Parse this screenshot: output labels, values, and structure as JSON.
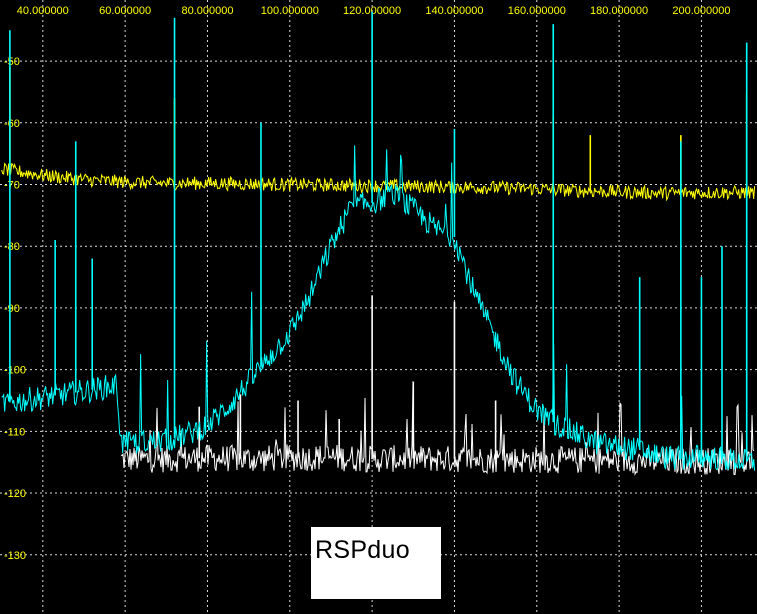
{
  "chart_data": {
    "type": "line",
    "title": "",
    "xlabel": "",
    "ylabel": "",
    "x_tick_labels": [
      "40.000000",
      "60.000000",
      "80.000000",
      "100.000000",
      "120.000000",
      "140.000000",
      "160.000000",
      "180.000000",
      "200.000000"
    ],
    "x_ticks": [
      40,
      60,
      80,
      100,
      120,
      140,
      160,
      180,
      200
    ],
    "y_tick_labels": [
      "-50",
      "-60",
      "-70",
      "-80",
      "-90",
      "-100",
      "-110",
      "-120",
      "-130"
    ],
    "y_ticks": [
      -50,
      -60,
      -70,
      -80,
      -90,
      -100,
      -110,
      -120,
      -130
    ],
    "xlim": [
      29.6,
      213.5
    ],
    "ylim": [
      -139.6,
      -40.1
    ],
    "grid": true,
    "colors": {
      "background": "#000000",
      "grid": "#ffffff",
      "tick_labels": "#ffff00",
      "series_yellow": "#ffff00",
      "series_cyan": "#00ffff",
      "series_white": "#ffffff"
    },
    "series": [
      {
        "color": "#ffff00",
        "x": [
          30,
          40,
          50,
          60,
          70,
          80,
          90,
          100,
          110,
          120,
          130,
          140,
          150,
          160,
          170,
          180,
          190,
          200,
          213
        ],
        "y": [
          -67.5,
          -68.5,
          -69.2,
          -69.6,
          -69.8,
          -69.8,
          -69.9,
          -70.0,
          -70.1,
          -70.2,
          -70.3,
          -70.4,
          -70.5,
          -70.7,
          -71.0,
          -71.2,
          -71.4,
          -71.3,
          -71.3
        ],
        "spikes": [
          {
            "x": 32,
            "y": -51
          },
          {
            "x": 72,
            "y": -56
          },
          {
            "x": 164,
            "y": -59
          },
          {
            "x": 173,
            "y": -62
          },
          {
            "x": 195,
            "y": -62
          },
          {
            "x": 211,
            "y": -55
          }
        ]
      },
      {
        "color": "#00ffff",
        "x": [
          30,
          40,
          50,
          58,
          59,
          70,
          75,
          80,
          85,
          90,
          95,
          100,
          105,
          110,
          115,
          120,
          125,
          130,
          135,
          140,
          145,
          150,
          155,
          160,
          165,
          170,
          175,
          180,
          185,
          190,
          195,
          200,
          205,
          213
        ],
        "y": [
          -105.5,
          -104.5,
          -103.5,
          -102.5,
          -112.0,
          -111.5,
          -110.5,
          -109.0,
          -106.0,
          -102.0,
          -98.0,
          -94.0,
          -88.0,
          -80.0,
          -73.5,
          -73.0,
          -71.5,
          -74.0,
          -77.0,
          -78.5,
          -88.0,
          -95.0,
          -102.0,
          -106.5,
          -109.0,
          -110.5,
          -112.0,
          -112.5,
          -113.0,
          -114.0,
          -114.5,
          -114.0,
          -114.5,
          -115.0
        ],
        "spikes": [
          {
            "x": 32,
            "y": -45
          },
          {
            "x": 43,
            "y": -79
          },
          {
            "x": 48,
            "y": -63
          },
          {
            "x": 52,
            "y": -82
          },
          {
            "x": 72,
            "y": -43
          },
          {
            "x": 93,
            "y": -60
          },
          {
            "x": 120,
            "y": -42
          },
          {
            "x": 140,
            "y": -61
          },
          {
            "x": 164,
            "y": -44
          },
          {
            "x": 185,
            "y": -85
          },
          {
            "x": 195,
            "y": -63
          },
          {
            "x": 200,
            "y": -85
          },
          {
            "x": 205,
            "y": -80
          },
          {
            "x": 211,
            "y": -47
          }
        ]
      },
      {
        "color": "#ffffff",
        "x": [
          59,
          70,
          80,
          90,
          100,
          110,
          120,
          130,
          140,
          150,
          160,
          170,
          180,
          190,
          200,
          213
        ],
        "y": [
          -114.5,
          -114.5,
          -114.3,
          -114.5,
          -114.3,
          -114.2,
          -114.5,
          -114.4,
          -114.5,
          -114.6,
          -114.6,
          -114.7,
          -114.7,
          -114.8,
          -114.8,
          -114.9
        ],
        "spikes": [
          {
            "x": 120,
            "y": -88
          },
          {
            "x": 140,
            "y": -89
          },
          {
            "x": 102,
            "y": -105
          },
          {
            "x": 112,
            "y": -108
          },
          {
            "x": 130,
            "y": -102
          },
          {
            "x": 150,
            "y": -105
          },
          {
            "x": 88,
            "y": -104
          },
          {
            "x": 78,
            "y": -106
          }
        ]
      }
    ]
  },
  "label_box": {
    "text": "RSPduo"
  }
}
